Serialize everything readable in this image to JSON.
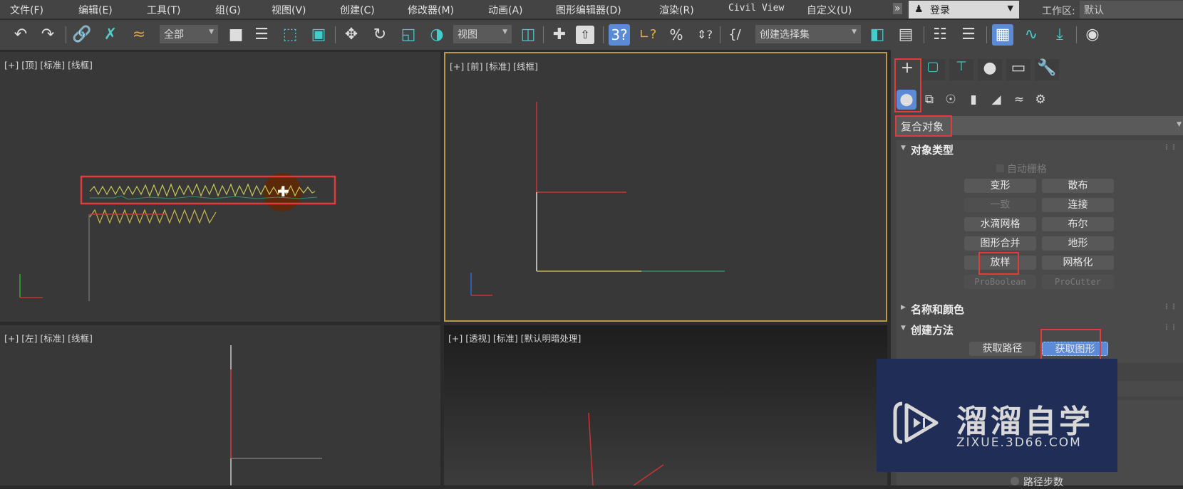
{
  "menu": [
    "文件(F)",
    "编辑(E)",
    "工具(T)",
    "组(G)",
    "视图(V)",
    "创建(C)",
    "修改器(M)",
    "动画(A)",
    "图形编辑器(D)",
    "渲染(R)",
    "Civil View",
    "自定义(U)"
  ],
  "overflow": "»",
  "login": {
    "icon": "user-icon",
    "label": "登录"
  },
  "workspace": {
    "label": "工作区:",
    "value": "默认"
  },
  "toolbar": {
    "selection_filter": "全部",
    "reference_coord": "视图",
    "named_selection": "创建选择集",
    "icons": [
      "undo-icon",
      "redo-icon",
      "link-icon",
      "unlink-icon",
      "bind-space-warp-icon",
      "select-object-icon",
      "select-by-name-icon",
      "rect-selection-icon",
      "window-crossing-icon",
      "move-icon",
      "rotate-icon",
      "scale-icon",
      "placement-icon",
      "pivot-icon",
      "keyboard-shortcut-icon",
      "snap-3d-icon",
      "angle-snap-icon",
      "percent-snap-icon",
      "spinner-snap-icon",
      "edit-named-sets-icon",
      "mirror-icon",
      "align-icon",
      "scene-explorer-icon",
      "layer-explorer-icon",
      "ribbon-icon",
      "curve-editor-icon",
      "schematic-icon",
      "material-editor-icon"
    ],
    "accent": "#5b8ad6"
  },
  "viewports": {
    "top": {
      "label": "[+] [顶] [标准] [线框]"
    },
    "front": {
      "label": "[+] [前] [标准] [线框]",
      "active_border": "#b8964a"
    },
    "left": {
      "label": "[+] [左] [标准] [线框]"
    },
    "perspective": {
      "label": "[+] [透视] [标准] [默认明暗处理]"
    }
  },
  "panel": {
    "tabs": [
      "create-icon",
      "modify-icon",
      "hierarchy-icon",
      "motion-icon",
      "display-icon",
      "utilities-icon"
    ],
    "subtabs": [
      "geometry-icon",
      "shapes-icon",
      "lights-icon",
      "cameras-icon",
      "helpers-icon",
      "space-warps-icon",
      "systems-icon"
    ],
    "category": "复合对象",
    "object_type": {
      "title": "对象类型",
      "autogrid": "自动栅格",
      "buttons": [
        {
          "label": "变形",
          "enabled": true
        },
        {
          "label": "散布",
          "enabled": true
        },
        {
          "label": "一致",
          "enabled": false
        },
        {
          "label": "连接",
          "enabled": true
        },
        {
          "label": "水滴网格",
          "enabled": true
        },
        {
          "label": "布尔",
          "enabled": true
        },
        {
          "label": "图形合并",
          "enabled": true
        },
        {
          "label": "地形",
          "enabled": true
        },
        {
          "label": "放样",
          "enabled": true
        },
        {
          "label": "网格化",
          "enabled": true
        },
        {
          "label": "ProBoolean",
          "enabled": false
        },
        {
          "label": "ProCutter",
          "enabled": false
        }
      ]
    },
    "name_color": {
      "title": "名称和颜色"
    },
    "creation_method": {
      "title": "创建方法",
      "get_path": "获取路径",
      "get_shape": "获取图形"
    },
    "path_steps": "路径步数",
    "highlight_color": "#e23b3b"
  },
  "watermark": {
    "title": "溜溜自学",
    "url": "ZIXUE.3D66.COM",
    "bg": "#1f2d57"
  }
}
